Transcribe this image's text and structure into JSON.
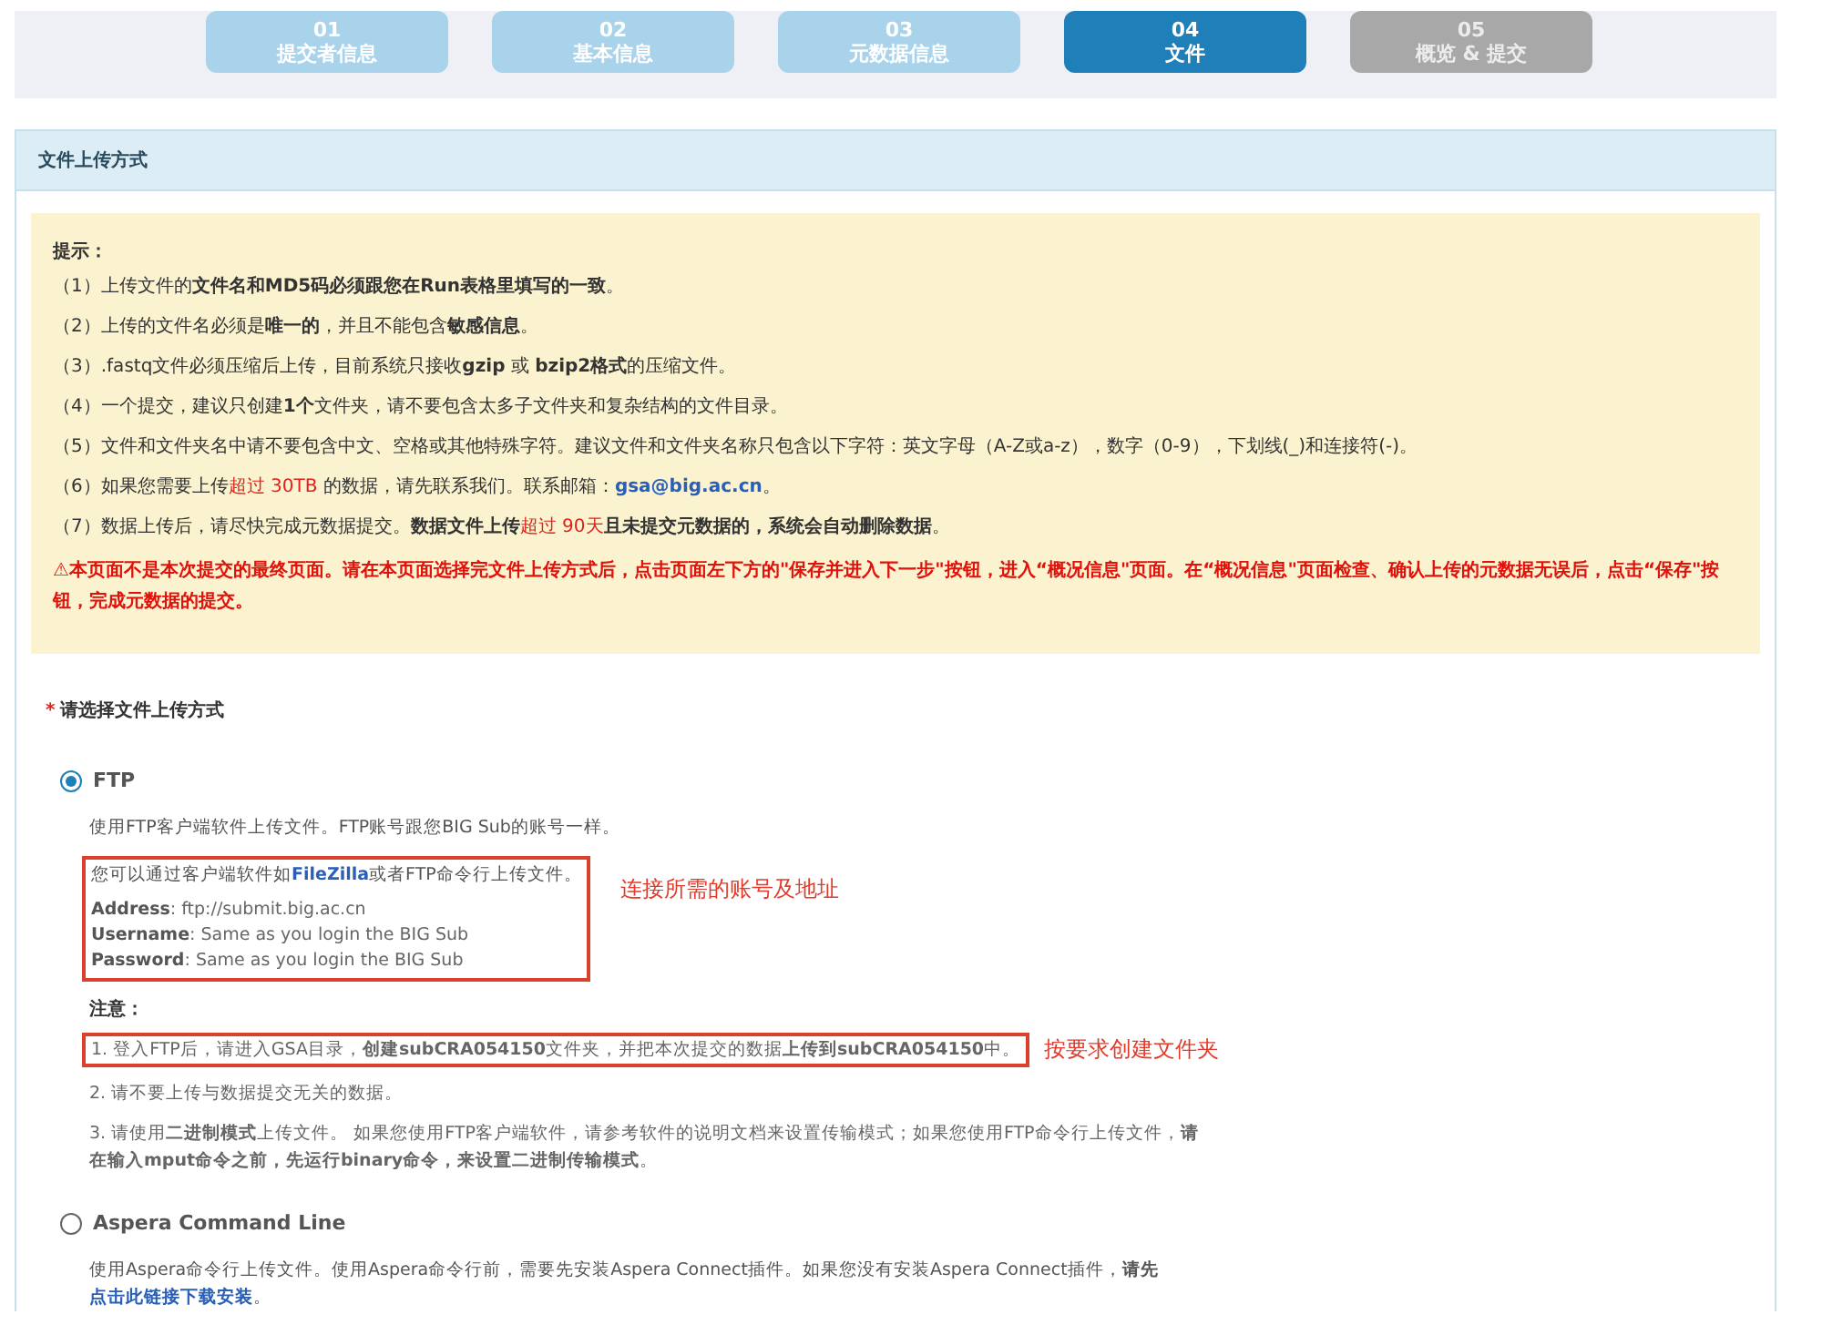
{
  "steps": [
    {
      "number": "01",
      "label": "提交者信息",
      "selected": false,
      "disabled": false
    },
    {
      "number": "02",
      "label": "基本信息",
      "selected": false,
      "disabled": false
    },
    {
      "number": "03",
      "label": "元数据信息",
      "selected": false,
      "disabled": false
    },
    {
      "number": "04",
      "label": "文件",
      "selected": true,
      "disabled": false
    },
    {
      "number": "05",
      "label": "概览 & 提交",
      "selected": false,
      "disabled": true
    }
  ],
  "panel": {
    "title": "文件上传方式",
    "notice": {
      "heading": "提示：",
      "items": [
        [
          {
            "text": "（1）上传文件的",
            "kind": "plain"
          },
          {
            "text": "文件名和MD5码必须跟您在Run表格里填写的一致",
            "kind": "strong"
          },
          {
            "text": "。",
            "kind": "plain"
          }
        ],
        [
          {
            "text": "（2）上传的文件名必须是",
            "kind": "plain"
          },
          {
            "text": "唯一的",
            "kind": "strong"
          },
          {
            "text": "，并且不能包含",
            "kind": "plain"
          },
          {
            "text": "敏感信息",
            "kind": "strong"
          },
          {
            "text": "。",
            "kind": "plain"
          }
        ],
        [
          {
            "text": "（3）.fastq文件必须压缩后上传，目前系统只接收",
            "kind": "plain"
          },
          {
            "text": "gzip",
            "kind": "strong"
          },
          {
            "text": " 或 ",
            "kind": "plain"
          },
          {
            "text": "bzip2格式",
            "kind": "strong"
          },
          {
            "text": "的压缩文件。",
            "kind": "plain"
          }
        ],
        [
          {
            "text": "（4）一个提交，建议只创建",
            "kind": "plain"
          },
          {
            "text": "1个",
            "kind": "strong"
          },
          {
            "text": "文件夹，请不要包含太多子文件夹和复杂结构的文件目录。",
            "kind": "plain"
          }
        ],
        [
          {
            "text": "（5）文件和文件夹名中请不要包含中文、空格或其他特殊字符。建议文件和文件夹名称只包含以下字符：英文字母（A-Z或a-z），数字（0-9），下划线(_)和连接符(-)。",
            "kind": "plain"
          }
        ],
        [
          {
            "text": "（6）如果您需要上传",
            "kind": "plain"
          },
          {
            "text": "超过 30TB",
            "kind": "alert"
          },
          {
            "text": " 的数据，请先联系我们。联系邮箱：",
            "kind": "plain"
          },
          {
            "text": "gsa@big.ac.cn",
            "kind": "link"
          },
          {
            "text": "。",
            "kind": "plain"
          }
        ],
        [
          {
            "text": "（7）数据上传后，请尽快完成元数据提交。",
            "kind": "plain"
          },
          {
            "text": "数据文件上传",
            "kind": "strong"
          },
          {
            "text": "超过 90天",
            "kind": "alert"
          },
          {
            "text": "且未提交元数据的，系统会自动删除数据",
            "kind": "strong"
          },
          {
            "text": "。",
            "kind": "plain"
          }
        ]
      ],
      "warning_icon": "⚠",
      "warning": "本页面不是本次提交的最终页面。请在本页面选择完文件上传方式后，点击页面左下方的\"保存并进入下一步\"按钮，进入“概况信息\"页面。在“概况信息\"页面检查、确认上传的元数据无误后，点击“保存\"按钮，完成元数据的提交。"
    },
    "required_mark": "*",
    "question": "请选择文件上传方式",
    "options": [
      {
        "label": "FTP",
        "selected": true,
        "description": [
          {
            "text": "使用FTP客户端软件上传文件。FTP账号跟您BIG Sub的账号一样。",
            "kind": "plain"
          }
        ],
        "client": {
          "intro": [
            {
              "text": "您可以通过客户端软件如",
              "kind": "plain"
            },
            {
              "text": "FileZilla",
              "kind": "link"
            },
            {
              "text": "或者FTP命令行上传文件。",
              "kind": "plain"
            }
          ],
          "fields": [
            "**Address**: ftp://submit.big.ac.cn",
            "**Username**: Same as you login the BIG Sub",
            "**Password**: Same as you login the BIG Sub"
          ],
          "annotation": "连接所需的账号及地址"
        },
        "notes_heading": "注意：",
        "notes": [
          {
            "parts": [
              {
                "text": "1. 登入FTP后，请进入GSA目录，",
                "kind": "plain"
              },
              {
                "text": "创建subCRA054150",
                "kind": "strong"
              },
              {
                "text": "文件夹，并把本次提交的数据",
                "kind": "plain"
              },
              {
                "text": "上传到subCRA054150",
                "kind": "strong"
              },
              {
                "text": "中。",
                "kind": "plain"
              }
            ],
            "annotation": "按要求创建文件夹"
          },
          {
            "parts": [
              {
                "text": "2. 请不要上传与数据提交无关的数据。",
                "kind": "plain"
              }
            ]
          },
          {
            "parts": [
              {
                "text": "3. 请使用",
                "kind": "plain"
              },
              {
                "text": "二进制模式",
                "kind": "strong"
              },
              {
                "text": "上传文件。 如果您使用FTP客户端软件，请参考软件的说明文档来设置传输模式；如果您使用FTP命令行上传文件，",
                "kind": "plain"
              },
              {
                "text": "请在输入mput命令之前，先运行binary命令，来设置二进制传输模式",
                "kind": "strong"
              },
              {
                "text": "。",
                "kind": "plain"
              }
            ]
          }
        ]
      },
      {
        "label": "Aspera Command Line",
        "selected": false,
        "description": [
          {
            "text": "使用Aspera命令行上传文件。使用Aspera命令行前，需要先安装Aspera Connect插件。如果您没有安装Aspera Connect插件，",
            "kind": "plain"
          },
          {
            "text": "请先",
            "kind": "strong"
          },
          {
            "text": "点击此链接下载安装",
            "kind": "link"
          },
          {
            "text": "。",
            "kind": "plain"
          }
        ]
      }
    ]
  }
}
